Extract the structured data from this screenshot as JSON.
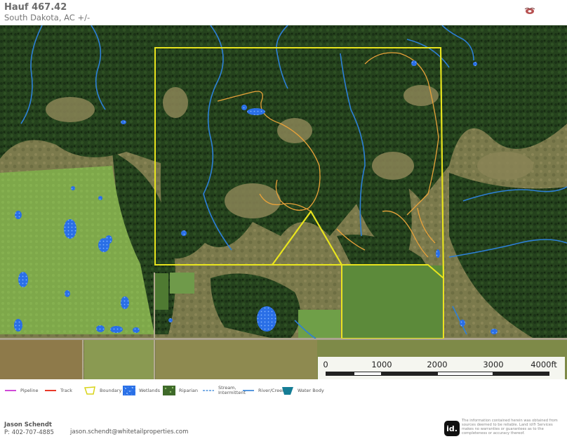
{
  "header": {
    "title": "Hauf 467.42",
    "subtitle": "South Dakota,  AC +/-"
  },
  "map": {
    "scale_bar": {
      "labels": [
        "0",
        "1000",
        "2000",
        "3000",
        "4000ft"
      ]
    },
    "colors": {
      "boundary": "#e8e41e",
      "pipeline": "#d04ad8",
      "track": "#e83a2a",
      "trail": "#e8a23a",
      "river": "#2d7fd6",
      "wetlands": "#2a6fe6",
      "forest": "#1f3a1a",
      "grassland": "#8a8a55",
      "cropland": "#7fa94a"
    }
  },
  "legend": {
    "items": [
      {
        "label": "Pipeline",
        "icon": "pipeline-line-icon"
      },
      {
        "label": "Track",
        "icon": "track-line-icon"
      },
      {
        "label": "Boundary",
        "icon": "boundary-polygon-icon"
      },
      {
        "label": "Wetlands",
        "icon": "wetlands-pattern-icon"
      },
      {
        "label": "Riparian",
        "icon": "riparian-pattern-icon"
      },
      {
        "label": "Stream, Intermittent",
        "icon": "stream-intermittent-icon"
      },
      {
        "label": "River/Creek",
        "icon": "river-line-icon"
      },
      {
        "label": "Water Body",
        "icon": "water-body-icon"
      }
    ]
  },
  "footer": {
    "agent_name": "Jason Schendt",
    "agent_phone": "P: 402-707-4885",
    "agent_email": "jason.schendt@whitetailproperties.com",
    "id_logo_text": "id.",
    "disclaimer": "The information contained herein was obtained from sources deemed to be reliable. Land id® Services makes no warranties or guarantees as to the completeness or accuracy thereof."
  }
}
